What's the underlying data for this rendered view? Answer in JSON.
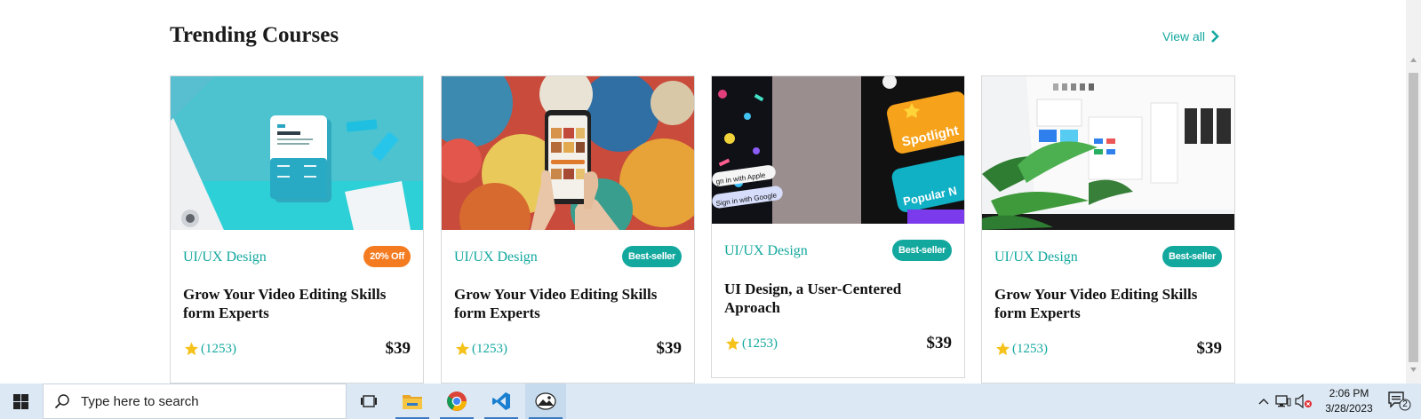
{
  "section": {
    "title": "Trending Courses",
    "view_all": "View all"
  },
  "cards": [
    {
      "category": "UI/UX Design",
      "badge": "20% Off",
      "badge_color": "#f47b1f",
      "title": "Grow Your Video Editing Skills form Experts",
      "rating": "(1253)",
      "price": "$39"
    },
    {
      "category": "UI/UX Design",
      "badge": "Best-seller",
      "badge_color": "#13a89e",
      "title": "Grow Your Video Editing Skills form Experts",
      "rating": "(1253)",
      "price": "$39"
    },
    {
      "category": "UI/UX Design",
      "badge": "Best-seller",
      "badge_color": "#13a89e",
      "title": "UI Design, a User-Centered Aproach",
      "rating": "(1253)",
      "price": "$39",
      "thumb_text": [
        "Spotlight",
        "Popular N",
        "gn in with Apple",
        "Sign in with Google"
      ]
    },
    {
      "category": "UI/UX Design",
      "badge": "Best-seller",
      "badge_color": "#13a89e",
      "title": "Grow Your Video Editing Skills form Experts",
      "rating": "(1253)",
      "price": "$39"
    }
  ],
  "taskbar": {
    "search_placeholder": "Type here to search",
    "time": "2:06 PM",
    "date": "3/28/2023",
    "notification_count": "2",
    "apps": [
      "task-view-icon",
      "file-explorer-icon",
      "chrome-icon",
      "vscode-icon",
      "photos-app-icon"
    ]
  },
  "colors": {
    "accent": "#13a89e",
    "orange": "#f47b1f",
    "taskbar": "#dce9f5"
  }
}
